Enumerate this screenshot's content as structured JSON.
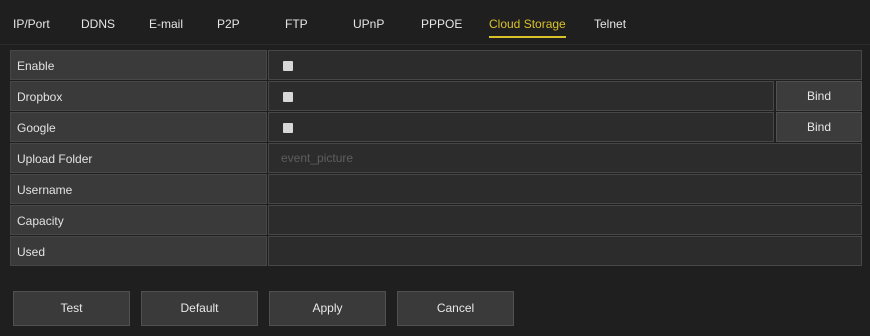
{
  "tabs": [
    {
      "label": "IP/Port",
      "active": false
    },
    {
      "label": "DDNS",
      "active": false
    },
    {
      "label": "E-mail",
      "active": false
    },
    {
      "label": "P2P",
      "active": false
    },
    {
      "label": "FTP",
      "active": false
    },
    {
      "label": "UPnP",
      "active": false
    },
    {
      "label": "PPPOE",
      "active": false
    },
    {
      "label": "Cloud Storage",
      "active": true
    },
    {
      "label": "Telnet",
      "active": false
    }
  ],
  "colors": {
    "accent": "#d9c12a",
    "background": "#1f1f1f",
    "label_cell": "#3a3a3a",
    "value_cell": "#2c2c2c"
  },
  "settings": {
    "enable": {
      "label": "Enable",
      "checked": false
    },
    "dropbox": {
      "label": "Dropbox",
      "checked": false,
      "button_label": "Bind"
    },
    "google": {
      "label": "Google",
      "checked": false,
      "button_label": "Bind"
    },
    "upload_folder": {
      "label": "Upload Folder",
      "placeholder": "event_picture",
      "value": ""
    },
    "username": {
      "label": "Username",
      "value": ""
    },
    "capacity": {
      "label": "Capacity",
      "value": ""
    },
    "used": {
      "label": "Used",
      "value": ""
    }
  },
  "buttons": {
    "test": "Test",
    "default": "Default",
    "apply": "Apply",
    "cancel": "Cancel"
  }
}
